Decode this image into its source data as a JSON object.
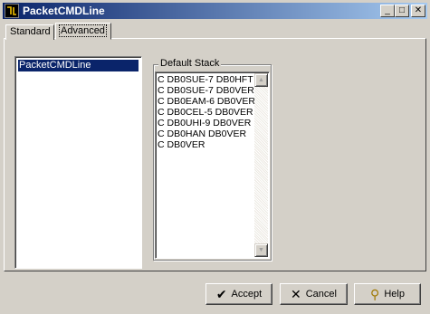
{
  "window": {
    "title": "PacketCMDLine",
    "minimize_label": "_",
    "maximize_label": "□",
    "close_label": "✕"
  },
  "tabs": [
    {
      "label": "Standard",
      "active": false
    },
    {
      "label": "Advanced",
      "active": true
    }
  ],
  "list": {
    "items": [
      "PacketCMDLine"
    ],
    "selected_index": 0
  },
  "default_stack": {
    "title": "Default Stack",
    "lines": [
      "C DB0SUE-7 DB0HFT",
      "C DB0SUE-7 DB0VER",
      "C DB0EAM-6 DB0VER",
      "C DB0CEL-5 DB0VER",
      "C DB0UHI-9 DB0VER",
      "C DB0HAN DB0VER",
      "C DB0VER"
    ],
    "scroll_up_icon": "▲",
    "scroll_down_icon": "▼"
  },
  "buttons": {
    "accept": {
      "label": "Accept",
      "icon": "✔"
    },
    "cancel": {
      "label": "Cancel",
      "icon": "✕"
    },
    "help": {
      "label": "Help",
      "icon": "⚲"
    }
  },
  "colors": {
    "title_bar_start": "#0a246a",
    "title_bar_end": "#a6caf0",
    "selection": "#0a246a",
    "face": "#d4d0c8"
  }
}
